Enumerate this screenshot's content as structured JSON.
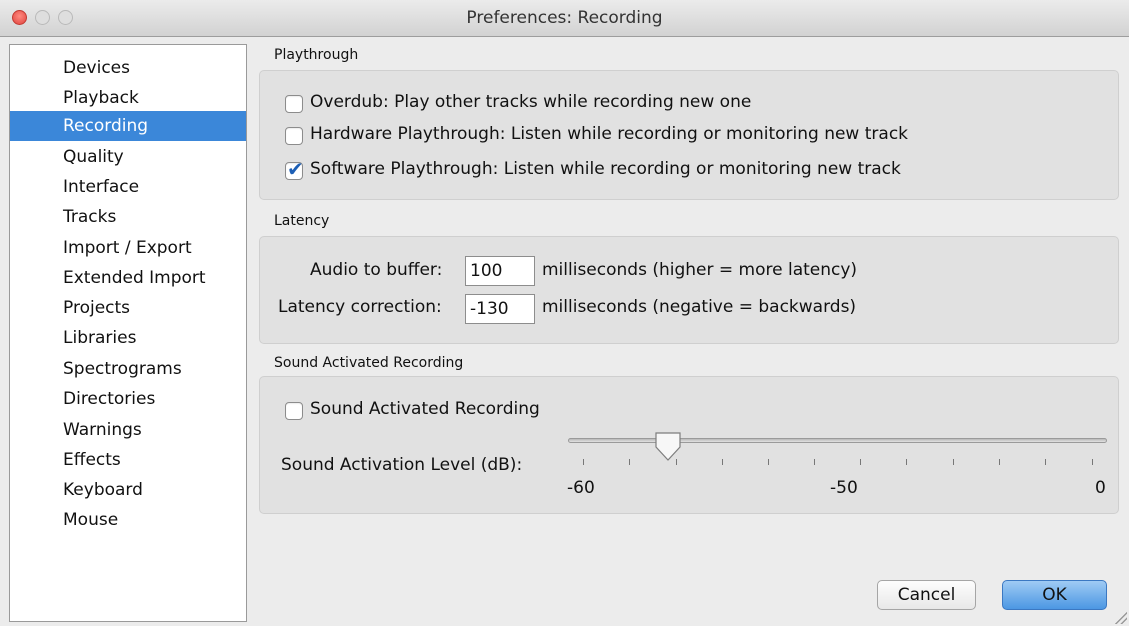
{
  "window": {
    "title": "Preferences: Recording"
  },
  "sidebar": {
    "items": [
      {
        "label": "Devices"
      },
      {
        "label": "Playback"
      },
      {
        "label": "Recording",
        "selected": true
      },
      {
        "label": "Quality"
      },
      {
        "label": "Interface"
      },
      {
        "label": "Tracks"
      },
      {
        "label": "Import / Export"
      },
      {
        "label": "Extended Import"
      },
      {
        "label": "Projects"
      },
      {
        "label": "Libraries"
      },
      {
        "label": "Spectrograms"
      },
      {
        "label": "Directories"
      },
      {
        "label": "Warnings"
      },
      {
        "label": "Effects"
      },
      {
        "label": "Keyboard"
      },
      {
        "label": "Mouse"
      }
    ]
  },
  "playthrough": {
    "title": "Playthrough",
    "overdub": {
      "label": "Overdub: Play other tracks while recording new one",
      "checked": false
    },
    "hardware": {
      "label": "Hardware Playthrough: Listen while recording or monitoring new track",
      "checked": false
    },
    "software": {
      "label": "Software Playthrough: Listen while recording or monitoring new track",
      "checked": true
    }
  },
  "latency": {
    "title": "Latency",
    "buffer_label": "Audio to buffer:",
    "buffer_value": "100",
    "buffer_unit": "milliseconds (higher = more latency)",
    "correction_label": "Latency correction:",
    "correction_value": "-130",
    "correction_unit": "milliseconds (negative = backwards)"
  },
  "sound_activated": {
    "title": "Sound Activated Recording",
    "checkbox_label": "Sound Activated Recording",
    "checked": false,
    "level_label": "Sound Activation Level (dB):",
    "level_value": -50,
    "scale_min": -60,
    "scale_max": 0,
    "tick_labels": [
      "-60",
      "-50",
      "0"
    ]
  },
  "buttons": {
    "cancel": "Cancel",
    "ok": "OK"
  },
  "colors": {
    "selection": "#3b87d9",
    "ok_button": "#4c97e3",
    "checkmark": "#1d5fb5"
  }
}
